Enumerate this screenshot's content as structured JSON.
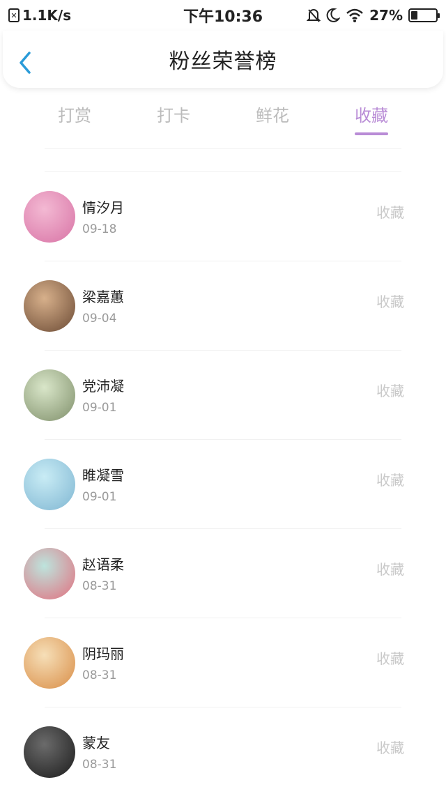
{
  "status_bar": {
    "network_speed": "1.1K/s",
    "time": "下午10:36",
    "battery_percent": "27%",
    "battery_level": 0.27
  },
  "header": {
    "title": "粉丝荣誉榜"
  },
  "tabs": [
    {
      "label": "打赏",
      "active": false
    },
    {
      "label": "打卡",
      "active": false
    },
    {
      "label": "鲜花",
      "active": false
    },
    {
      "label": "收藏",
      "active": true
    }
  ],
  "accent_color": "#b98cd6",
  "list": [
    {
      "name": "情汐月",
      "date": "09-18",
      "action": "收藏",
      "avatar_colors": [
        "#f3b9d3",
        "#d873a5"
      ]
    },
    {
      "name": "梁嘉蕙",
      "date": "09-04",
      "action": "收藏",
      "avatar_colors": [
        "#d7b08b",
        "#6b4a34"
      ]
    },
    {
      "name": "党沛凝",
      "date": "09-01",
      "action": "收藏",
      "avatar_colors": [
        "#d9e6c9",
        "#7f8f6a"
      ]
    },
    {
      "name": "睢凝雪",
      "date": "09-01",
      "action": "收藏",
      "avatar_colors": [
        "#c9ecf5",
        "#7fb6d2"
      ]
    },
    {
      "name": "赵语柔",
      "date": "08-31",
      "action": "收藏",
      "avatar_colors": [
        "#bde4dd",
        "#e26f7e"
      ]
    },
    {
      "name": "阴玛丽",
      "date": "08-31",
      "action": "收藏",
      "avatar_colors": [
        "#f6dfb8",
        "#d98d46"
      ]
    },
    {
      "name": "蒙友",
      "date": "08-31",
      "action": "收藏",
      "avatar_colors": [
        "#6b6b6b",
        "#1b1b1b"
      ]
    }
  ]
}
